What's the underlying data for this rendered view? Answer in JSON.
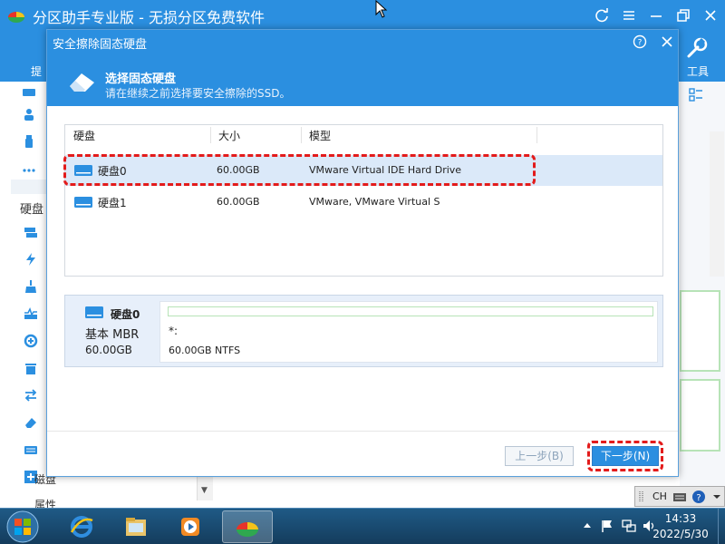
{
  "app": {
    "title": "分区助手专业版 - 无损分区免费软件",
    "ribbon_partial_label": "提",
    "tools_label": "工具"
  },
  "sidebar": {
    "section_label": "硬盘",
    "partial_items": [
      "磁盘",
      "属性"
    ]
  },
  "dialog": {
    "title": "安全擦除固态硬盘",
    "header_title": "选择固态硬盘",
    "header_subtitle": "请在继续之前选择要安全擦除的SSD。",
    "table": {
      "columns": [
        "硬盘",
        "大小",
        "模型"
      ],
      "rows": [
        {
          "disk": "硬盘0",
          "size": "60.00GB",
          "model": "VMware Virtual IDE Hard Drive",
          "selected": true
        },
        {
          "disk": "硬盘1",
          "size": "60.00GB",
          "model": "VMware, VMware Virtual S",
          "selected": false
        }
      ]
    },
    "details": {
      "disk_name": "硬盘0",
      "disk_type": "基本 MBR",
      "disk_size": "60.00GB",
      "partition_letter": "*:",
      "partition_info": "60.00GB NTFS"
    },
    "buttons": {
      "prev": "上一步(B)",
      "next": "下一步(N)"
    }
  },
  "langbar": {
    "lang": "CH"
  },
  "taskbar": {
    "time": "14:33",
    "date": "2022/5/30"
  },
  "colors": {
    "brand_blue": "#2b8fe0",
    "highlight_red": "#e31b1b",
    "selected_row": "#dbe9f9"
  }
}
